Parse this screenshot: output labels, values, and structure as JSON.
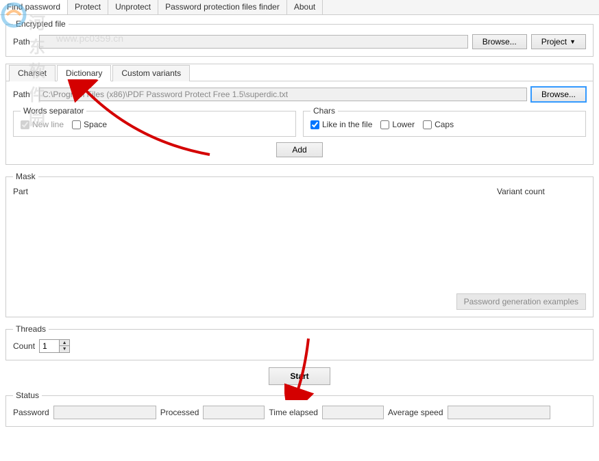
{
  "menu": {
    "items": [
      "Find password",
      "Protect",
      "Unprotect",
      "Password protection files finder",
      "About"
    ],
    "active_index": 0
  },
  "encrypted_file": {
    "legend": "Encrypted file",
    "path_label": "Path",
    "path_value": "",
    "browse": "Browse...",
    "project": "Project"
  },
  "attack_tabs": {
    "items": [
      "Charset",
      "Dictionary",
      "Custom variants"
    ],
    "active_index": 1
  },
  "dictionary": {
    "path_label": "Path",
    "path_value": "C:\\Program Files (x86)\\PDF Password Protect Free 1.5\\superdic.txt",
    "browse": "Browse...",
    "words_sep": {
      "legend": "Words separator",
      "newline": "New line",
      "space": "Space"
    },
    "chars": {
      "legend": "Chars",
      "like": "Like in the file",
      "lower": "Lower",
      "caps": "Caps"
    },
    "add_button": "Add"
  },
  "mask": {
    "legend": "Mask",
    "part": "Part",
    "variant_count": "Variant count",
    "pgen": "Password generation examples"
  },
  "threads": {
    "legend": "Threads",
    "count_label": "Count",
    "count_value": "1"
  },
  "start_button": "Start",
  "status": {
    "legend": "Status",
    "password": "Password",
    "processed": "Processed",
    "elapsed": "Time elapsed",
    "speed": "Average speed"
  },
  "watermark": {
    "line1": "河东软件园",
    "line2": "www.pc0359.cn"
  }
}
